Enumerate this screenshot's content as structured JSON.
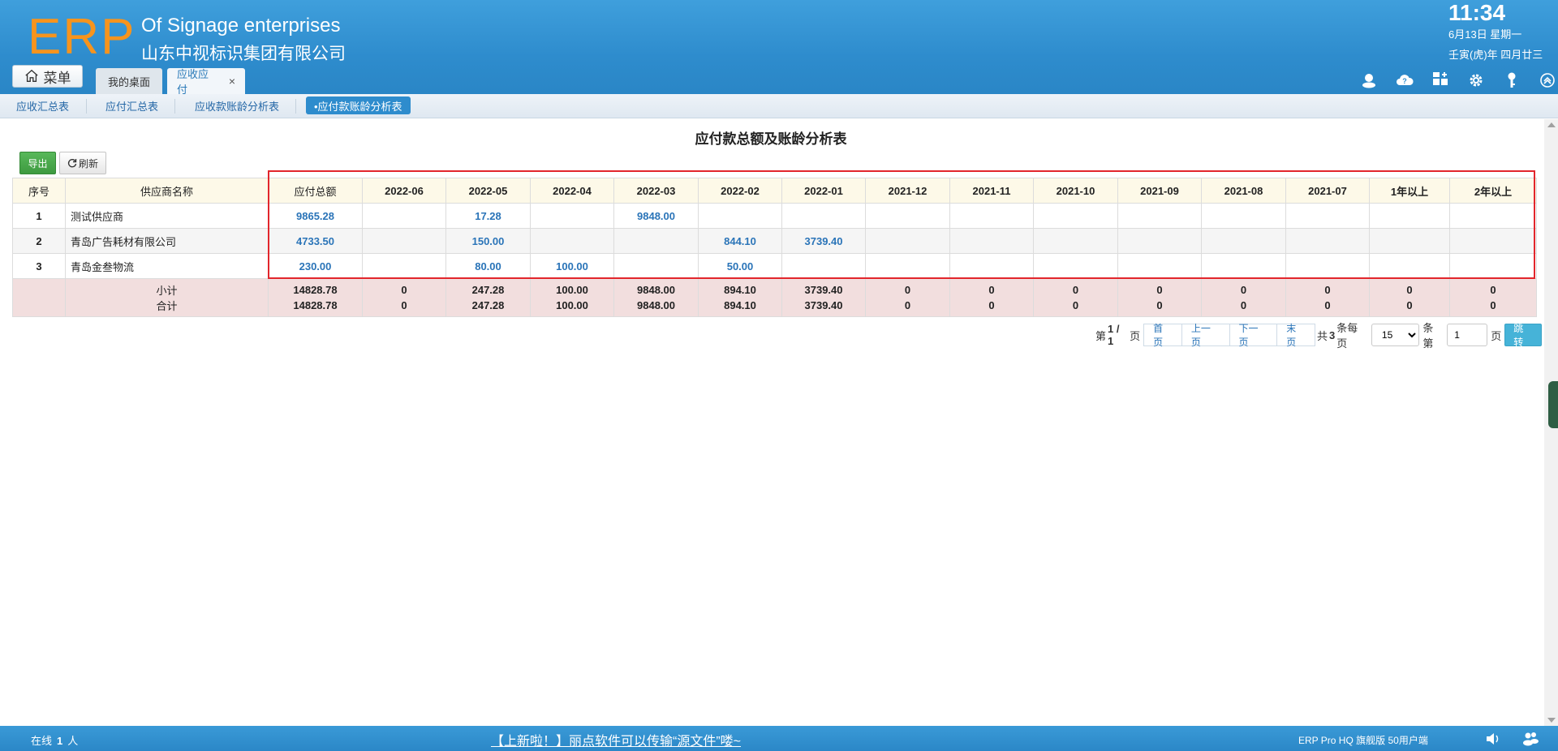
{
  "header": {
    "logo": "ERP",
    "company_en": "Of Signage enterprises",
    "company_cn": "山东中视标识集团有限公司",
    "time": "11:34",
    "date_line1": "6月13日 星期一",
    "date_line2": "壬寅(虎)年 四月廿三",
    "menu_label": "菜单",
    "tabs": [
      {
        "label": "我的桌面"
      },
      {
        "label": "应收应付",
        "close": "×"
      }
    ],
    "icons": [
      "user-icon",
      "cloud-help-icon",
      "grid-add-icon",
      "gear-icon",
      "key-icon",
      "collapse-up-icon"
    ]
  },
  "subtabs": [
    {
      "label": "应收汇总表"
    },
    {
      "label": "应付汇总表"
    },
    {
      "label": "应收款账龄分析表"
    },
    {
      "label": "•应付款账龄分析表",
      "active": true
    }
  ],
  "report": {
    "title": "应付款总额及账龄分析表",
    "export_label": "导出",
    "refresh_label": "刷新",
    "columns": [
      "序号",
      "供应商名称",
      "应付总额",
      "2022-06",
      "2022-05",
      "2022-04",
      "2022-03",
      "2022-02",
      "2022-01",
      "2021-12",
      "2021-11",
      "2021-10",
      "2021-09",
      "2021-08",
      "2021-07",
      "1年以上",
      "2年以上"
    ],
    "rows": [
      [
        "1",
        "测试供应商",
        "9865.28",
        "",
        "17.28",
        "",
        "9848.00",
        "",
        "",
        "",
        "",
        "",
        "",
        "",
        "",
        "",
        ""
      ],
      [
        "2",
        "青岛广告耗材有限公司",
        "4733.50",
        "",
        "150.00",
        "",
        "",
        "844.10",
        "3739.40",
        "",
        "",
        "",
        "",
        "",
        "",
        "",
        ""
      ],
      [
        "3",
        "青岛金叁物流",
        "230.00",
        "",
        "80.00",
        "100.00",
        "",
        "50.00",
        "",
        "",
        "",
        "",
        "",
        "",
        "",
        "",
        ""
      ]
    ],
    "subtotal": [
      "",
      "小计",
      "14828.78",
      "0",
      "247.28",
      "100.00",
      "9848.00",
      "894.10",
      "3739.40",
      "0",
      "0",
      "0",
      "0",
      "0",
      "0",
      "0",
      "0"
    ],
    "total": [
      "",
      "合计",
      "14828.78",
      "0",
      "247.28",
      "100.00",
      "9848.00",
      "894.10",
      "3739.40",
      "0",
      "0",
      "0",
      "0",
      "0",
      "0",
      "0",
      "0"
    ]
  },
  "pager": {
    "page_prefix": "第",
    "page_info": "1 / 1",
    "page_suffix": "页",
    "first": "首页",
    "prev": "上一页",
    "next": "下一页",
    "last": "末页",
    "count_prefix": "共",
    "count": "3",
    "count_mid": "条每页",
    "page_size": "15",
    "page_size_options": [
      "15"
    ],
    "goto_prefix": "条第",
    "goto_value": "1",
    "goto_suffix": "页",
    "go_label": "跳转"
  },
  "footer": {
    "online_label": "在线",
    "online_count": "1",
    "online_unit": "人",
    "notice": "【上新啦！】丽点软件可以传输“源文件”喽~",
    "edition": "ERP Pro HQ 旗舰版 50用户端"
  },
  "colors": {
    "header_blue": "#2e8ccd",
    "logo_orange": "#f7941d",
    "link_blue": "#2a74b8",
    "export_green": "#3e9a40",
    "highlight_red": "#e2262c",
    "total_bg": "#f2dede"
  }
}
